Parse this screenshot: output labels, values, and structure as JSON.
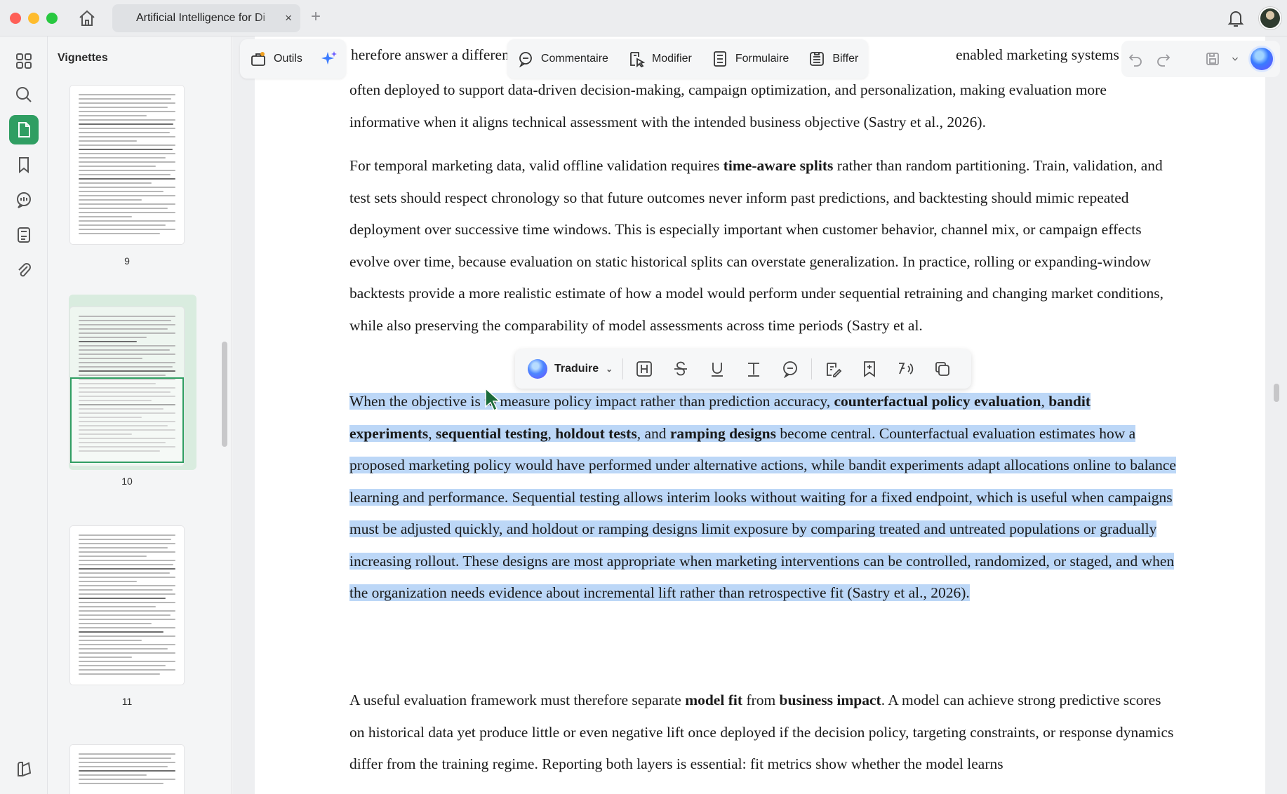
{
  "window": {
    "tab_title": "Artificial Intelligence for Di",
    "tab_close": "×",
    "tab_add": "+"
  },
  "thumbnails": {
    "title": "Vignettes",
    "pages": [
      {
        "number": "9"
      },
      {
        "number": "10",
        "selected": true
      },
      {
        "number": "11"
      }
    ]
  },
  "toolbar": {
    "tools_label": "Outils",
    "comment_label": "Commentaire",
    "edit_label": "Modifier",
    "form_label": "Formulaire",
    "strike_label": "Biffer",
    "behind_left": "herefore answer a different quest",
    "behind_right": "enabled marketing systems"
  },
  "selection_toolbar": {
    "translate_label": "Traduire",
    "chevron": "⌄"
  },
  "colors": {
    "accent": "#2f9e62",
    "selection": "#bcd7f7"
  },
  "document": {
    "p1": "often deployed to support data-driven decision-making, campaign optimization, and personalization, making evaluation more informative when it aligns technical assessment with the intended business objective (Sastry et al., 2026).",
    "p2_a": "For temporal marketing data, valid offline validation requires ",
    "p2_b": "time-aware splits",
    "p2_c": " rather than random partitioning. Train, validation, and test sets should respect chronology so that future outcomes never inform past predictions, and backtesting should mimic repeated deployment over successive time windows. This is especially important when customer behavior, channel mix, or campaign effects evolve over time, because evaluation on static historical splits can overstate generalization. In practice, rolling or expanding-window backtests provide a more realistic estimate of how a model would perform under sequential retraining and changing market conditions, while also preserving the comparability of model assessments across time periods (Sastry et al.",
    "p3_a": "When the objective is to measure policy impact rather than prediction accuracy, ",
    "p3_b": "counterfactual policy evaluation",
    "p3_c": ", ",
    "p3_d": "bandit experiments",
    "p3_e": ", ",
    "p3_f": "sequential testing",
    "p3_g": ", ",
    "p3_h": "holdout tests",
    "p3_i": ", and ",
    "p3_j": "ramping designs",
    "p3_k": " become central. Counterfactual evaluation estimates how a proposed marketing policy would have performed under alternative actions, while bandit experiments adapt allocations online to balance learning and performance. Sequential testing allows interim looks without waiting for a fixed endpoint, which is useful when campaigns must be adjusted quickly, and holdout or ramping designs limit exposure by comparing treated and untreated populations or gradually increasing rollout. These designs are most appropriate when marketing interventions can be controlled, randomized, or staged, and when the organization needs evidence about incremental lift rather than retrospective fit (Sastry et al., 2026).",
    "p4_a": "A useful evaluation framework must therefore separate ",
    "p4_b": "model fit",
    "p4_c": " from ",
    "p4_d": "business impact",
    "p4_e": ". A model can achieve strong predictive scores on historical data yet produce little or even negative lift once deployed if the decision policy, targeting constraints, or response dynamics differ from the training regime. Reporting both layers is essential: fit metrics show whether the model learns"
  }
}
